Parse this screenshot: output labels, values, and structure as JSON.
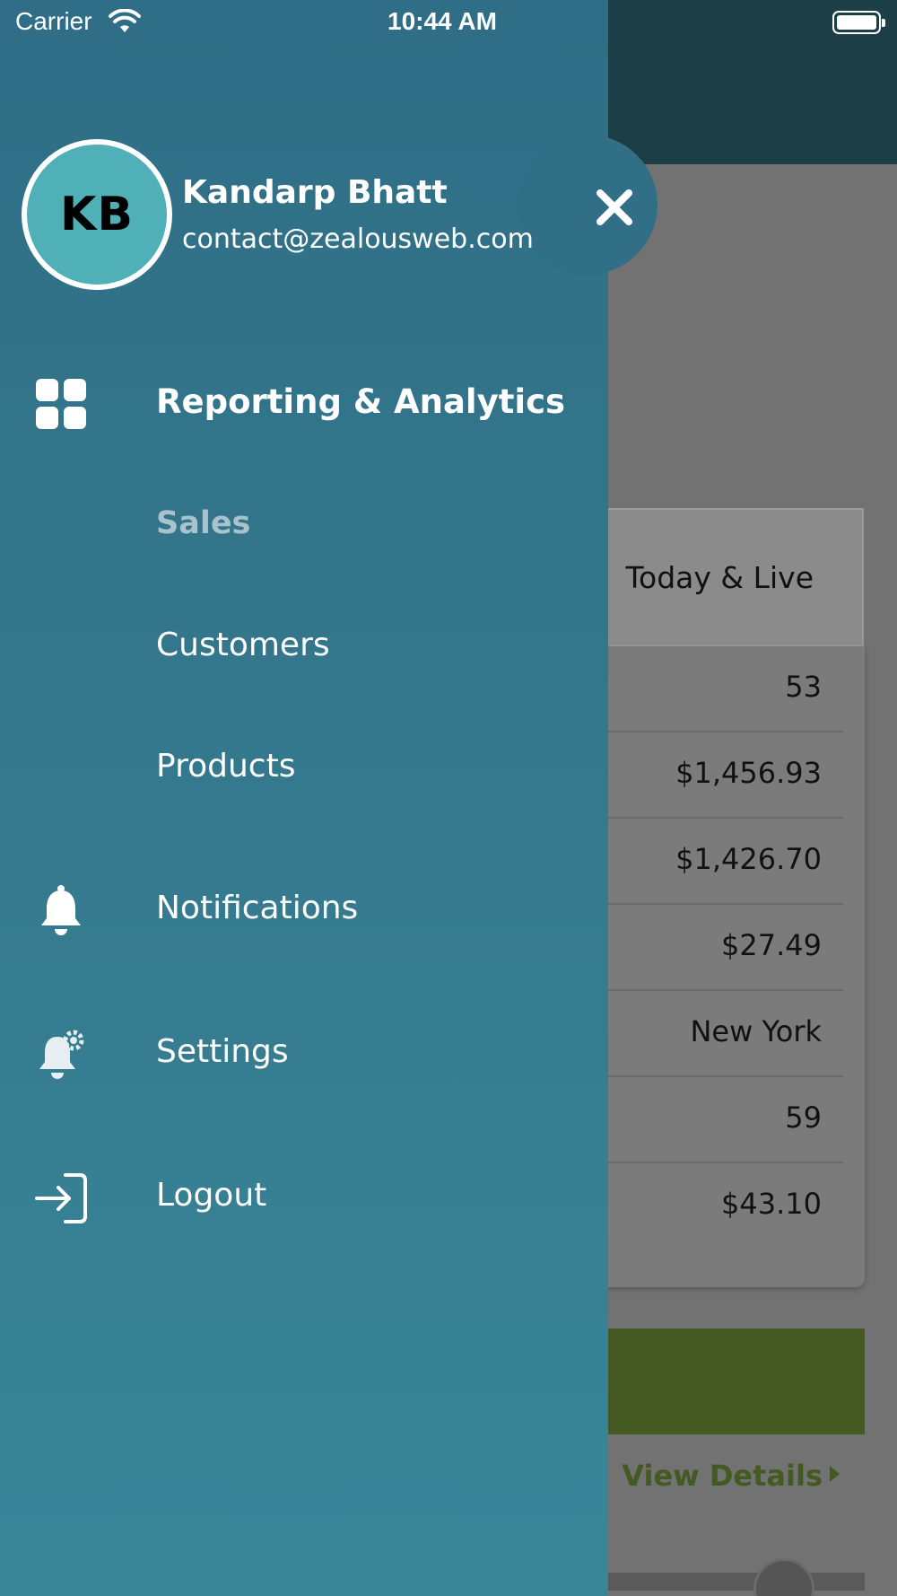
{
  "status_bar": {
    "carrier": "Carrier",
    "time": "10:44 AM"
  },
  "drawer": {
    "user": {
      "initials": "KB",
      "name": "Kandarp Bhatt",
      "email": "contact@zealousweb.com"
    },
    "menu": [
      {
        "label": "Reporting & Analytics",
        "icon": "grid-icon",
        "bold": true
      },
      {
        "label": "Sales",
        "active": true
      },
      {
        "label": "Customers"
      },
      {
        "label": "Products"
      },
      {
        "label": "Notifications",
        "icon": "bell-icon"
      },
      {
        "label": "Settings",
        "icon": "bell-gear-icon"
      },
      {
        "label": "Logout",
        "icon": "logout-icon"
      }
    ]
  },
  "background": {
    "tab_label": "Today & Live",
    "rows": [
      "53",
      "$1,456.93",
      "$1,426.70",
      "$27.49",
      "New York",
      "59",
      "$43.10"
    ],
    "view_details": "View Details"
  },
  "colors": {
    "drawer_top": "#2f6e86",
    "drawer_bottom": "#3a8699",
    "avatar": "#4fb0b8",
    "header_bg": "#1c3f47",
    "green_accent": "#445a22"
  }
}
